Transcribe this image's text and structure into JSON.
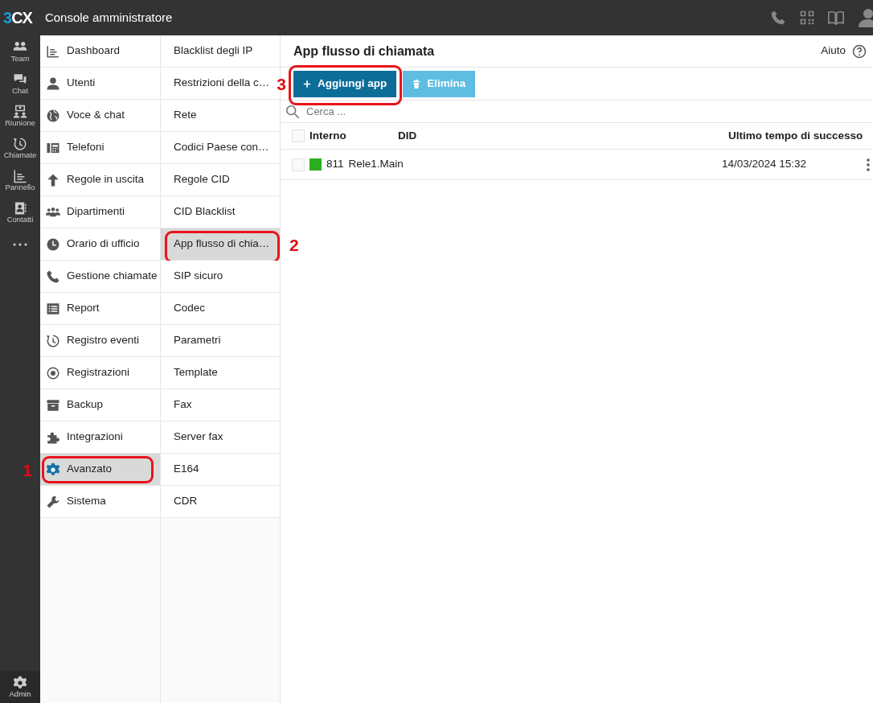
{
  "app": {
    "logo": [
      "3",
      "CX"
    ],
    "title": "Console amministratore"
  },
  "rail": {
    "items": [
      {
        "label": "Team",
        "selected": false
      },
      {
        "label": "Chat",
        "selected": false
      },
      {
        "label": "Riunione",
        "selected": false
      },
      {
        "label": "Chiamate",
        "selected": false
      },
      {
        "label": "Pannello",
        "selected": false
      },
      {
        "label": "Contatti",
        "selected": false
      }
    ],
    "admin": {
      "label": "Admin",
      "selected": true
    }
  },
  "nav": {
    "items": [
      {
        "label": "Dashboard",
        "selected": false
      },
      {
        "label": "Utenti",
        "selected": false
      },
      {
        "label": "Voce & chat",
        "selected": false
      },
      {
        "label": "Telefoni",
        "selected": false
      },
      {
        "label": "Regole in uscita",
        "selected": false
      },
      {
        "label": "Dipartimenti",
        "selected": false
      },
      {
        "label": "Orario di ufficio",
        "selected": false
      },
      {
        "label": "Gestione chiamate",
        "selected": false
      },
      {
        "label": "Report",
        "selected": false
      },
      {
        "label": "Registro eventi",
        "selected": false
      },
      {
        "label": "Registrazioni",
        "selected": false
      },
      {
        "label": "Backup",
        "selected": false
      },
      {
        "label": "Integrazioni",
        "selected": false
      },
      {
        "label": "Avanzato",
        "selected": true,
        "annotation": "1"
      },
      {
        "label": "Sistema",
        "selected": false
      }
    ]
  },
  "subnav": {
    "items": [
      {
        "label": "Blacklist degli IP",
        "selected": false
      },
      {
        "label": "Restrizioni della c…",
        "selected": false
      },
      {
        "label": "Rete",
        "selected": false
      },
      {
        "label": "Codici Paese con…",
        "selected": false
      },
      {
        "label": "Regole CID",
        "selected": false
      },
      {
        "label": "CID Blacklist",
        "selected": false
      },
      {
        "label": "App flusso di chia…",
        "selected": true,
        "annotation": "2"
      },
      {
        "label": "SIP sicuro",
        "selected": false
      },
      {
        "label": "Codec",
        "selected": false
      },
      {
        "label": "Parametri",
        "selected": false
      },
      {
        "label": "Template",
        "selected": false
      },
      {
        "label": "Fax",
        "selected": false
      },
      {
        "label": "Server fax",
        "selected": false
      },
      {
        "label": "E164",
        "selected": false
      },
      {
        "label": "CDR",
        "selected": false
      }
    ]
  },
  "main": {
    "title": "App flusso di chiamata",
    "help": "Aiuto",
    "toolbar": [
      {
        "kind": "add",
        "label": "Aggiungi app",
        "disabled": false,
        "annotation": "3"
      },
      {
        "kind": "delete",
        "label": "Elimina",
        "disabled": true
      }
    ],
    "search": {
      "placeholder": "Cerca ..."
    },
    "table": {
      "header_checked": false,
      "columns": [
        "Interno",
        "DID",
        "Ultimo tempo di successo"
      ],
      "rows": [
        {
          "checked": false,
          "color": "#2aae1f",
          "number": "811",
          "name": "Rele1.Main",
          "last_success": "14/03/2024 15:32"
        }
      ]
    }
  }
}
